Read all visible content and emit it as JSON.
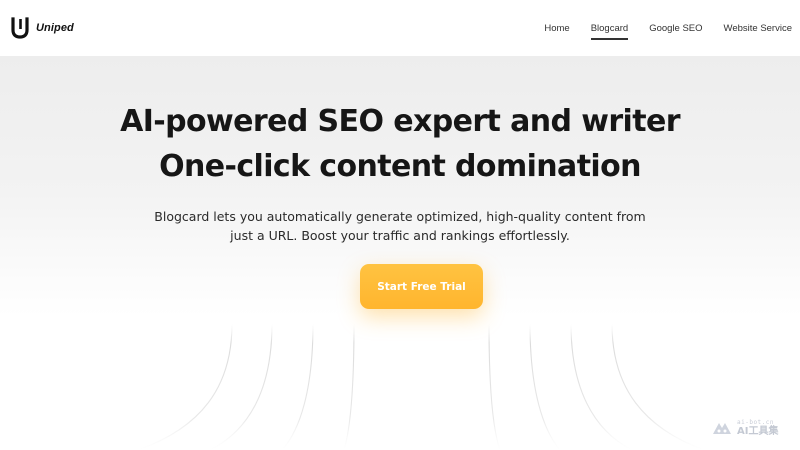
{
  "brand": {
    "name": "Uniped",
    "logo_icon": "u-logo-icon"
  },
  "nav": {
    "items": [
      {
        "label": "Home",
        "active": false
      },
      {
        "label": "Blogcard",
        "active": true
      },
      {
        "label": "Google SEO",
        "active": false
      },
      {
        "label": "Website Service",
        "active": false
      }
    ]
  },
  "hero": {
    "headline_line1": "AI-powered SEO expert and writer",
    "headline_line2": "One-click content domination",
    "description_line1": "Blogcard lets you automatically generate optimized, high-quality content from",
    "description_line2": "just a URL. Boost your traffic and rankings effortlessly.",
    "cta_label": "Start Free Trial"
  },
  "watermark": {
    "icon": "ai-bot-logo-icon",
    "domain": "ai-bot.cn",
    "name": "AI工具集"
  },
  "colors": {
    "accent": "#FFB52E",
    "text": "#161616",
    "background": "#FFFFFF",
    "hero_top": "#EDEDED"
  }
}
